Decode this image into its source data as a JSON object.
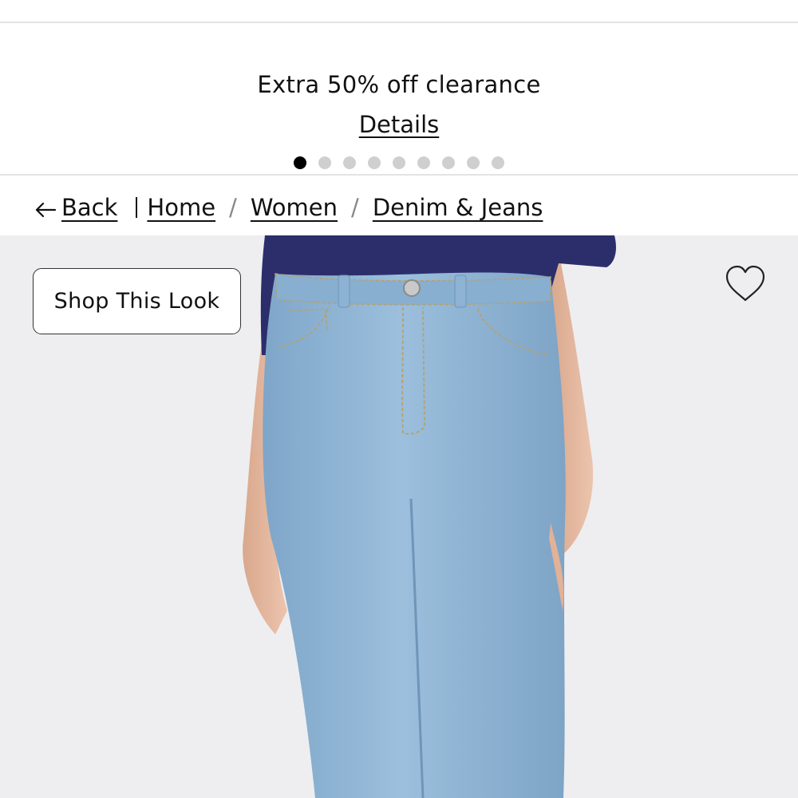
{
  "promo": {
    "headline": "Extra 50% off clearance",
    "link_label": "Details",
    "carousel": {
      "total": 9,
      "active_index": 0
    }
  },
  "breadcrumb": {
    "back_label": "Back",
    "back_icon": "arrow-left-icon",
    "items": [
      "Home",
      "Women",
      "Denim & Jeans"
    ],
    "separator": "/"
  },
  "product_image": {
    "shop_look_label": "Shop This Look",
    "wishlist_icon": "heart-outline-icon"
  },
  "colors": {
    "sweater": "#2c2e6b",
    "denim": "#8fb4d4",
    "skin": "#e4b9a0",
    "background": "#eeeef0"
  }
}
